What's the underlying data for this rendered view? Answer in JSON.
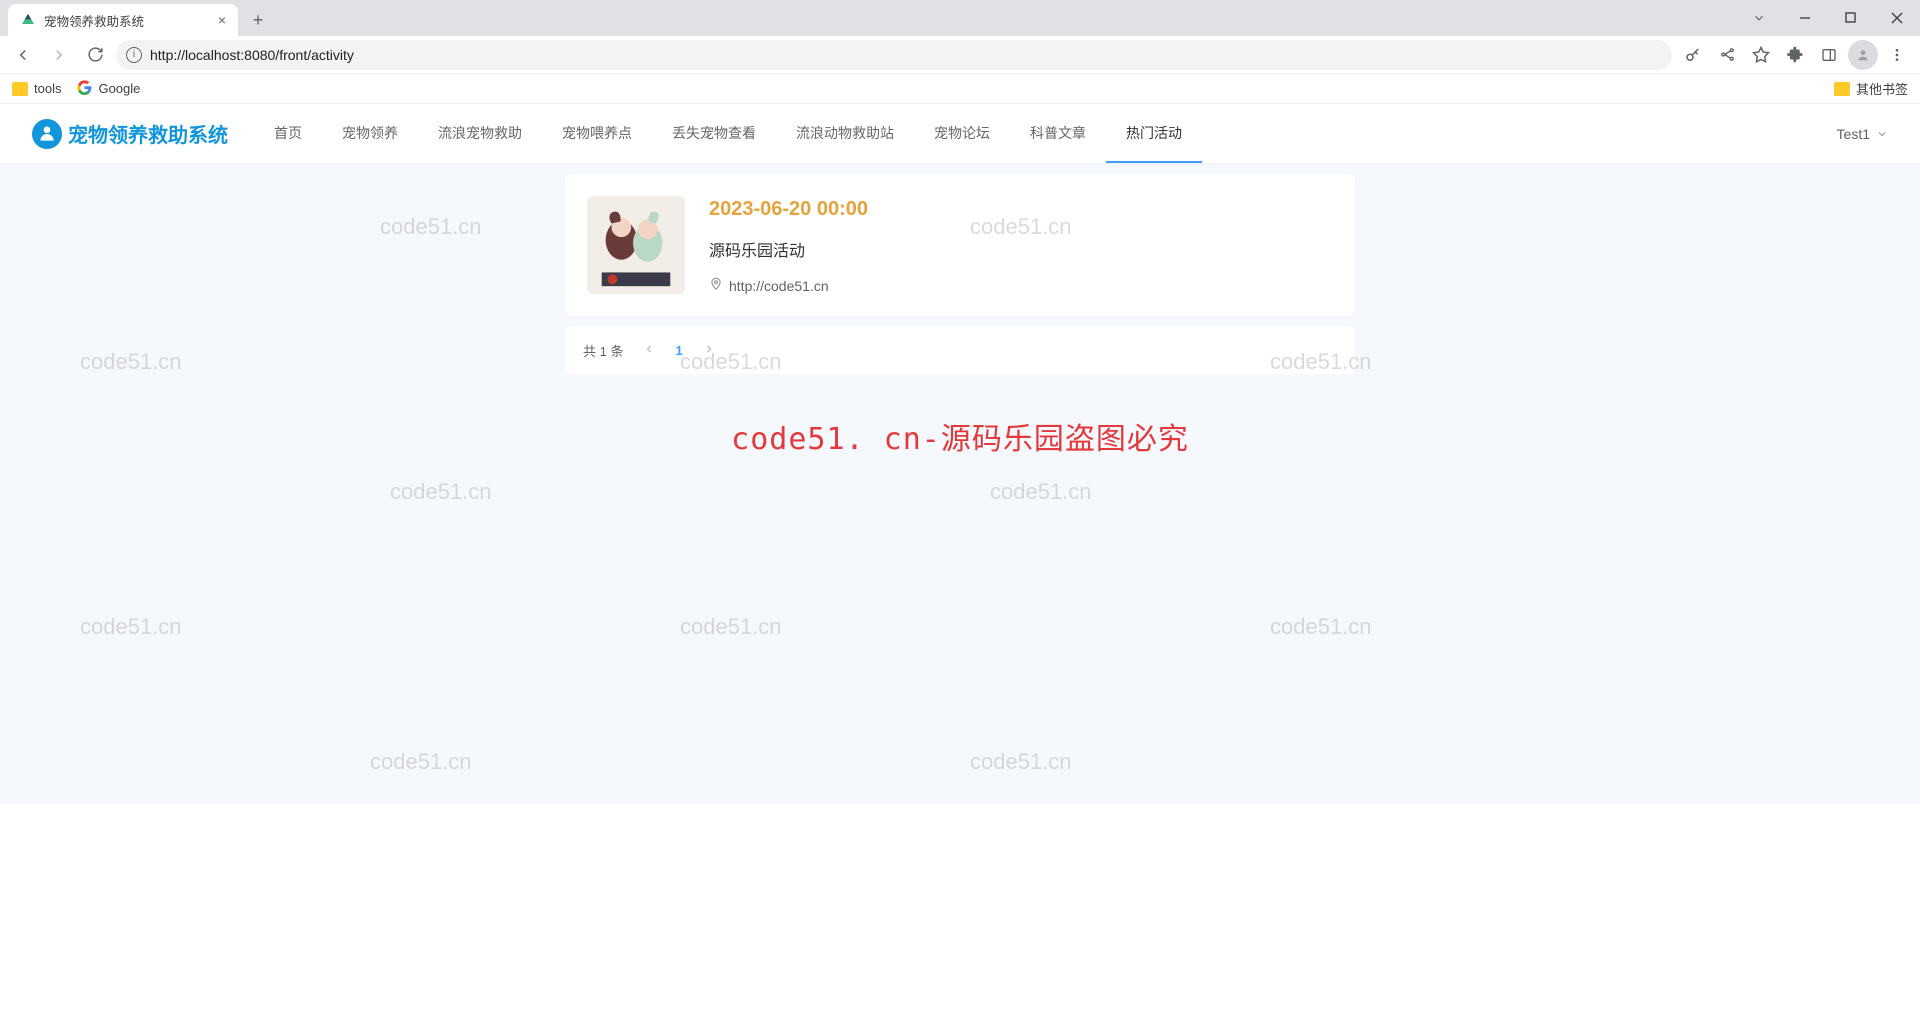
{
  "browser": {
    "tab_title": "宠物领养救助系统",
    "url": "http://localhost:8080/front/activity",
    "bookmarks": {
      "tools": "tools",
      "google": "Google",
      "other": "其他书签"
    }
  },
  "header": {
    "logo_text": "宠物领养救助系统",
    "nav": [
      "首页",
      "宠物领养",
      "流浪宠物救助",
      "宠物喂养点",
      "丢失宠物查看",
      "流浪动物救助站",
      "宠物论坛",
      "科普文章",
      "热门活动"
    ],
    "active_index": 8,
    "user": "Test1"
  },
  "activity": {
    "items": [
      {
        "date": "2023-06-20 00:00",
        "title": "源码乐园活动",
        "location": "http://code51.cn"
      }
    ],
    "pagination": {
      "total_text": "共 1 条",
      "current": "1"
    }
  },
  "watermark_text": "code51.cn",
  "center_warning": "code51. cn-源码乐园盗图必究"
}
